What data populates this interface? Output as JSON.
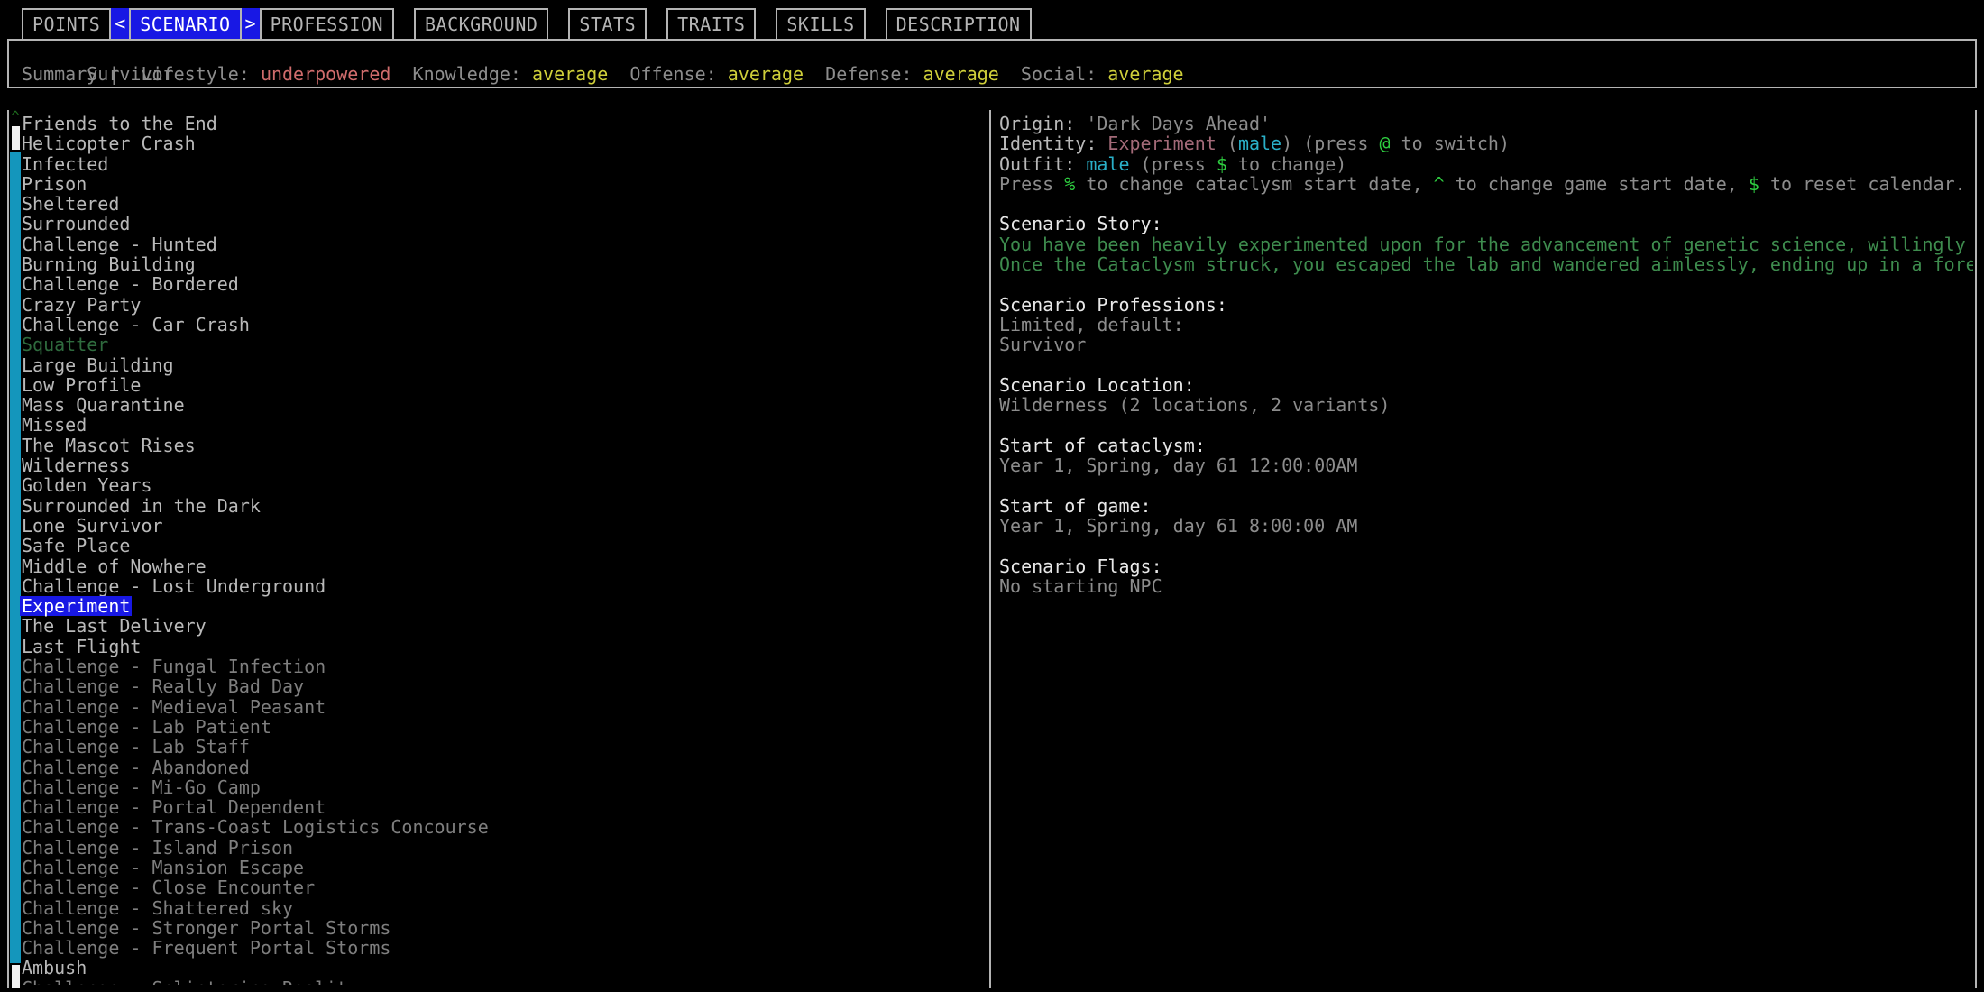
{
  "tabs": [
    {
      "label": "POINTS",
      "active": false
    },
    {
      "label": "SCENARIO",
      "active": true
    },
    {
      "label": "PROFESSION",
      "active": false
    },
    {
      "label": "BACKGROUND",
      "active": false
    },
    {
      "label": "STATS",
      "active": false
    },
    {
      "label": "TRAITS",
      "active": false
    },
    {
      "label": "SKILLS",
      "active": false
    },
    {
      "label": "DESCRIPTION",
      "active": false
    }
  ],
  "nav": {
    "prev_arrow": "<",
    "next_arrow": ">"
  },
  "summary": {
    "profession": "Survivor",
    "label": "Summary |",
    "stats": [
      {
        "name": "Lifestyle:",
        "value": "underpowered",
        "color": "#d06c6c"
      },
      {
        "name": "Knowledge:",
        "value": "average",
        "color": "#cfcf3a"
      },
      {
        "name": "Offense:",
        "value": "average",
        "color": "#cfcf3a"
      },
      {
        "name": "Defense:",
        "value": "average",
        "color": "#cfcf3a"
      },
      {
        "name": "Social:",
        "value": "average",
        "color": "#cfcf3a"
      }
    ]
  },
  "scenario_list": [
    {
      "label": "Friends to the End",
      "style": "normal"
    },
    {
      "label": "Helicopter Crash",
      "style": "normal"
    },
    {
      "label": "Infected",
      "style": "normal"
    },
    {
      "label": "Prison",
      "style": "normal"
    },
    {
      "label": "Sheltered",
      "style": "normal"
    },
    {
      "label": "Surrounded",
      "style": "normal"
    },
    {
      "label": "Challenge - Hunted",
      "style": "normal"
    },
    {
      "label": "Burning Building",
      "style": "normal"
    },
    {
      "label": "Challenge - Bordered",
      "style": "normal"
    },
    {
      "label": "Crazy Party",
      "style": "normal"
    },
    {
      "label": "Challenge - Car Crash",
      "style": "normal"
    },
    {
      "label": "Squatter",
      "style": "green"
    },
    {
      "label": "Large Building",
      "style": "normal"
    },
    {
      "label": "Low Profile",
      "style": "normal"
    },
    {
      "label": "Mass Quarantine",
      "style": "normal"
    },
    {
      "label": "Missed",
      "style": "normal"
    },
    {
      "label": "The Mascot Rises",
      "style": "normal"
    },
    {
      "label": "Wilderness",
      "style": "normal"
    },
    {
      "label": "Golden Years",
      "style": "normal"
    },
    {
      "label": "Surrounded in the Dark",
      "style": "normal"
    },
    {
      "label": "Lone Survivor",
      "style": "normal"
    },
    {
      "label": "Safe Place",
      "style": "normal"
    },
    {
      "label": "Middle of Nowhere",
      "style": "normal"
    },
    {
      "label": "Challenge - Lost Underground",
      "style": "normal"
    },
    {
      "label": "Experiment",
      "style": "selected"
    },
    {
      "label": "The Last Delivery",
      "style": "normal"
    },
    {
      "label": "Last Flight",
      "style": "normal"
    },
    {
      "label": "Challenge - Fungal Infection",
      "style": "dim"
    },
    {
      "label": "Challenge - Really Bad Day",
      "style": "dim"
    },
    {
      "label": "Challenge - Medieval Peasant",
      "style": "dim"
    },
    {
      "label": "Challenge - Lab Patient",
      "style": "dim"
    },
    {
      "label": "Challenge - Lab Staff",
      "style": "dim"
    },
    {
      "label": "Challenge - Abandoned",
      "style": "dim"
    },
    {
      "label": "Challenge - Mi-Go Camp",
      "style": "dim"
    },
    {
      "label": "Challenge - Portal Dependent",
      "style": "dim"
    },
    {
      "label": "Challenge - Trans-Coast Logistics Concourse",
      "style": "dim"
    },
    {
      "label": "Challenge - Island Prison",
      "style": "dim"
    },
    {
      "label": "Challenge - Mansion Escape",
      "style": "dim"
    },
    {
      "label": "Challenge - Close Encounter",
      "style": "dim"
    },
    {
      "label": "Challenge - Shattered sky",
      "style": "dim"
    },
    {
      "label": "Challenge - Stronger Portal Storms",
      "style": "dim"
    },
    {
      "label": "Challenge - Frequent Portal Storms",
      "style": "dim"
    },
    {
      "label": "Ambush",
      "style": "normal"
    },
    {
      "label": "Challenge - Splintering Reality",
      "style": "dim"
    }
  ],
  "detail": {
    "origin_label": "Origin: ",
    "origin_value": "'Dark Days Ahead'",
    "identity_label": "Identity: ",
    "identity_name": "Experiment",
    "identity_mid_open": " (",
    "identity_gender": "male",
    "identity_mid_close": ") (press ",
    "identity_key": "@",
    "identity_tail": " to switch)",
    "outfit_label": "Outfit: ",
    "outfit_value": "male",
    "outfit_mid": " (press ",
    "outfit_key": "$",
    "outfit_tail": " to change)",
    "press_pre": "Press ",
    "press_key1": "%",
    "press_mid1": " to change cataclysm start date, ",
    "press_key2": "^",
    "press_mid2": " to change game start date, ",
    "press_key3": "$",
    "press_tail": " to reset calendar.",
    "story_header": "Scenario Story:",
    "story_lines": [
      "You have been heavily experimented upon for the advancement of genetic science, willingly or not.",
      "Once the Cataclysm struck, you escaped the lab and wandered aimlessly, ending up in a forest."
    ],
    "professions_header": "Scenario Professions:",
    "professions_lines": [
      "Limited, default:",
      "Survivor"
    ],
    "location_header": "Scenario Location:",
    "location_value": "Wilderness (2 locations, 2 variants)",
    "cataclysm_header": "Start of cataclysm:",
    "cataclysm_value": "Year 1, Spring, day 61 12:00:00AM",
    "game_header": "Start of game:",
    "game_value": "Year 1, Spring, day 61 8:00:00 AM",
    "flags_header": "Scenario Flags:",
    "flags_value": "No starting NPC"
  },
  "scrollbar": {
    "up_arrow": "^"
  }
}
